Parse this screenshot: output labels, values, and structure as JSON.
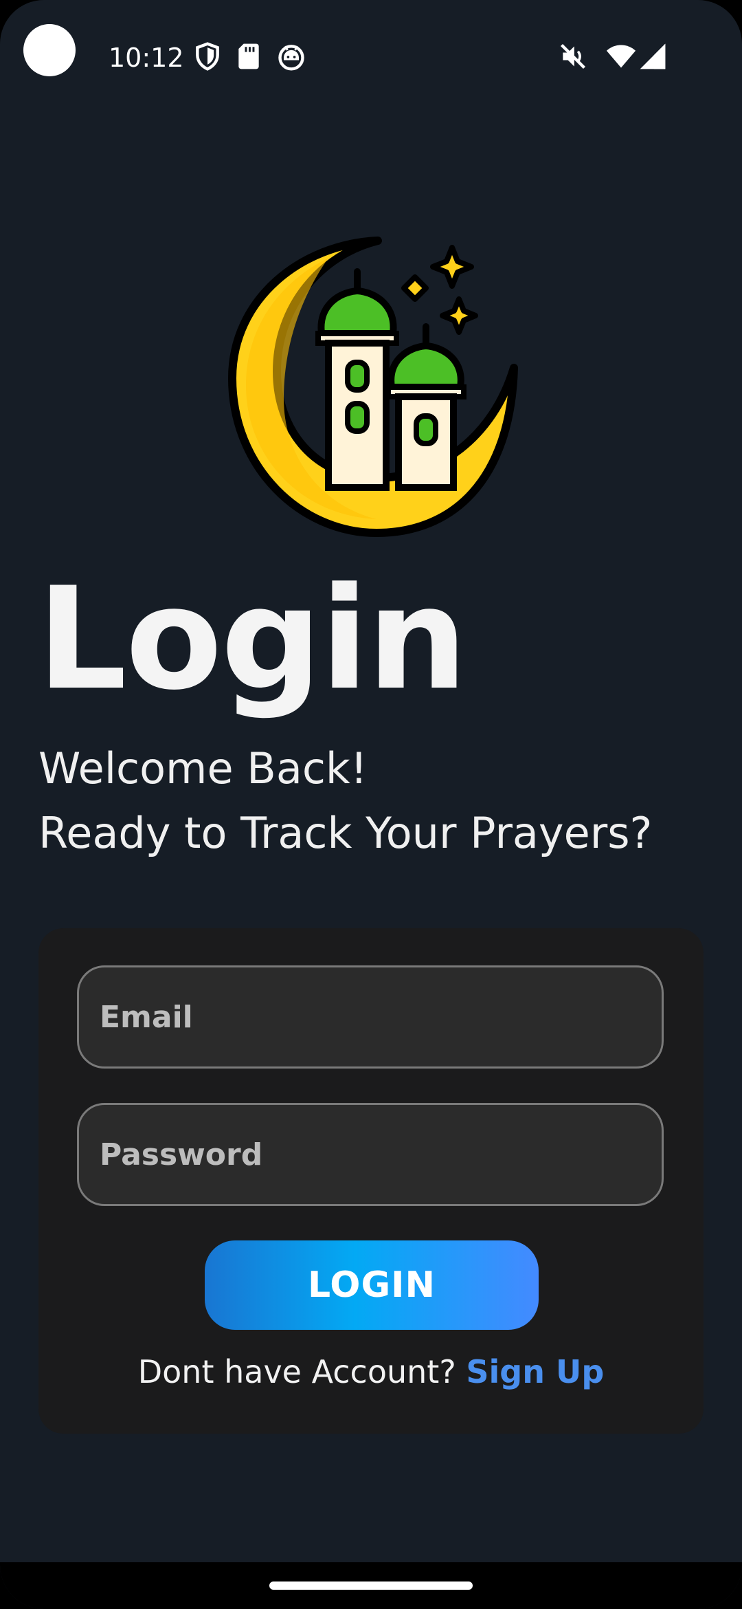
{
  "status_bar": {
    "time": "10:12",
    "left_icons": [
      "shield-icon",
      "sd-card-icon",
      "android-face-icon"
    ],
    "right_icons": [
      "mute-vibrate-icon",
      "wifi-icon",
      "cell-signal-icon"
    ]
  },
  "header": {
    "title": "Login",
    "subtitle_line1": "Welcome Back!",
    "subtitle_line2": "Ready to Track Your Prayers?"
  },
  "form": {
    "email_placeholder": "Email",
    "password_placeholder": "Password",
    "login_label": "LOGIN",
    "signup_prompt": "Dont have Account?",
    "signup_link": "Sign Up"
  },
  "colors": {
    "background": "#161d26",
    "card": "#1b1b1c",
    "accent_link": "#4a8fee",
    "button_gradient": [
      "#1976d2",
      "#03a9f4",
      "#448aff"
    ],
    "moon_yellow": "#ffd11a",
    "dome_green": "#4cbf26"
  },
  "logo": {
    "icon": "crescent-mosque-icon"
  }
}
